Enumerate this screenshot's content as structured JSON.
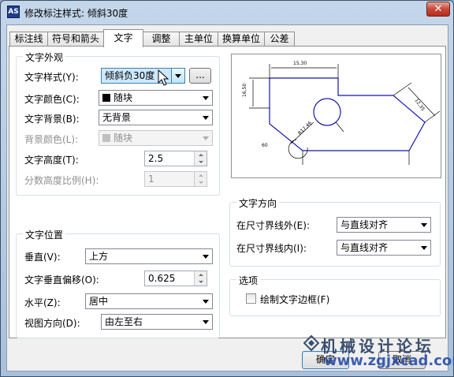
{
  "window": {
    "title": "修改标注样式: 倾斜30度",
    "close_symbol": "✕",
    "app_icon_label": "AS"
  },
  "tabs": [
    {
      "label": "标注线",
      "active": false
    },
    {
      "label": "符号和箭头",
      "active": false
    },
    {
      "label": "文字",
      "active": true
    },
    {
      "label": "调整",
      "active": false
    },
    {
      "label": "主单位",
      "active": false
    },
    {
      "label": "换算单位",
      "active": false
    },
    {
      "label": "公差",
      "active": false
    }
  ],
  "appearance": {
    "title": "文字外观",
    "style_label": "文字样式(Y):",
    "style_value": "倾斜负30度",
    "style_button": "...",
    "color_label": "文字颜色(C):",
    "color_value": "随块",
    "fill_label": "文字背景(B):",
    "fill_value": "无背景",
    "fill_color_label": "背景颜色(L):",
    "fill_color_value": "随块",
    "height_label": "文字高度(T):",
    "height_value": "2.5",
    "fraction_label": "分数高度比例(H):",
    "fraction_value": "1"
  },
  "placement": {
    "title": "文字位置",
    "vertical_label": "垂直(V):",
    "vertical_value": "上方",
    "offset_label": "文字垂直偏移(O):",
    "offset_value": "0.625",
    "horizontal_label": "水平(Z):",
    "horizontal_value": "居中",
    "view_label": "视图方向(D):",
    "view_value": "由左至右"
  },
  "alignment": {
    "title": "文字方向",
    "outside_label": "在尺寸界线外(E):",
    "outside_value": "与直线对齐",
    "inside_label": "在尺寸界线内(I):",
    "inside_value": "与直线对齐"
  },
  "options": {
    "title": "选项",
    "frame_label": "绘制文字边框(F)",
    "frame_checked": false
  },
  "preview": {
    "dim_top": "15,30",
    "dim_left": "16,50",
    "dim_right": "12,35",
    "dim_radius": "R17,46",
    "dim_bottom": "60"
  },
  "buttons": {
    "ok": "确定",
    "cancel": "取消"
  },
  "watermark": {
    "title": "机械设计论坛",
    "url": "www.zgjxcad.com"
  },
  "colors": {
    "preview_outline": "#1515a8",
    "window_frame": "#c4d6ea"
  }
}
